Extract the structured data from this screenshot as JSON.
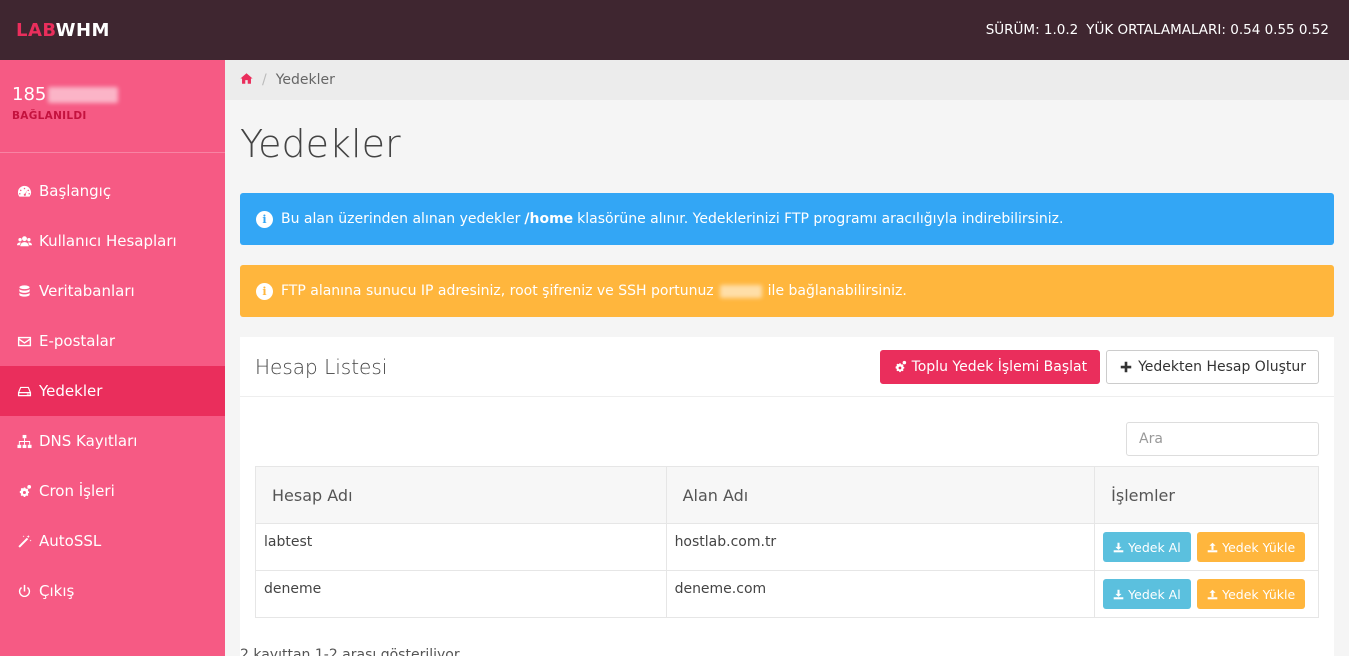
{
  "brand": {
    "part1": "LAB",
    "part2": "WHM"
  },
  "topbar": {
    "version": "SÜRÜM: 1.0.2",
    "load": "YÜK ORTALAMALARI: 0.54 0.55 0.52"
  },
  "server": {
    "ip_prefix": "185",
    "status": "BAĞLANILDI"
  },
  "sidebar": {
    "items": [
      {
        "label": "Başlangıç",
        "icon": "dashboard-icon"
      },
      {
        "label": "Kullanıcı Hesapları",
        "icon": "users-icon"
      },
      {
        "label": "Veritabanları",
        "icon": "database-icon"
      },
      {
        "label": "E-postalar",
        "icon": "envelope-icon"
      },
      {
        "label": "Yedekler",
        "icon": "hdd-icon",
        "active": true
      },
      {
        "label": "DNS Kayıtları",
        "icon": "sitemap-icon"
      },
      {
        "label": "Cron İşleri",
        "icon": "cogs-icon"
      },
      {
        "label": "AutoSSL",
        "icon": "magic-icon"
      },
      {
        "label": "Çıkış",
        "icon": "power-icon"
      }
    ]
  },
  "breadcrumb": {
    "current": "Yedekler",
    "separator": "/"
  },
  "page": {
    "title": "Yedekler"
  },
  "alerts": {
    "info": {
      "pre": "Bu alan üzerinden alınan yedekler",
      "bold": "/home",
      "post": "klasörüne alınır. Yedeklerinizi FTP programı aracılığıyla indirebilirsiniz."
    },
    "warn": {
      "pre": "FTP alanına sunucu IP adresiniz, root şifreniz ve SSH portunuz",
      "post": "ile bağlanabilirsiniz."
    }
  },
  "panel": {
    "title": "Hesap Listesi",
    "bulk_backup_label": "Toplu Yedek İşlemi Başlat",
    "create_from_backup_label": "Yedekten Hesap Oluştur",
    "search_placeholder": "Ara"
  },
  "table": {
    "headers": [
      "Hesap Adı",
      "Alan Adı",
      "İşlemler"
    ],
    "rows": [
      {
        "account": "labtest",
        "domain": "hostlab.com.tr"
      },
      {
        "account": "deneme",
        "domain": "deneme.com"
      }
    ],
    "backup_label": "Yedek Al",
    "upload_label": "Yedek Yükle"
  },
  "footer": {
    "info": "2 kayıttan 1-2 arası gösteriliyor"
  },
  "colors": {
    "accent": "#ea2e5c",
    "sidebar": "#f65a84",
    "topbar": "#3f2630",
    "info": "#33a6f5",
    "warning": "#ffb63d"
  }
}
